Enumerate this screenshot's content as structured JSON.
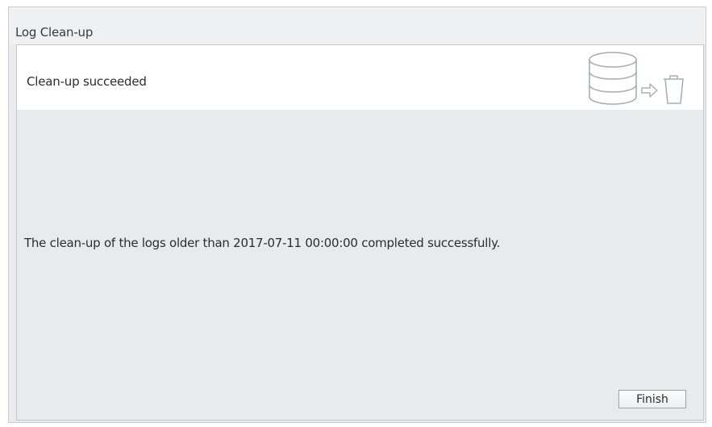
{
  "window": {
    "title": "Log Clean-up"
  },
  "banner": {
    "status_text": "Clean-up succeeded",
    "icons": [
      "database-icon",
      "arrow-right-icon",
      "trash-icon"
    ]
  },
  "main": {
    "message": "The clean-up of the logs older than 2017-07-11 00:00:00 completed successfully."
  },
  "footer": {
    "finish_label": "Finish"
  },
  "colors": {
    "panel_background": "#e8ebee",
    "banner_background": "#ffffff",
    "icon_stroke": "#a9adb2"
  }
}
